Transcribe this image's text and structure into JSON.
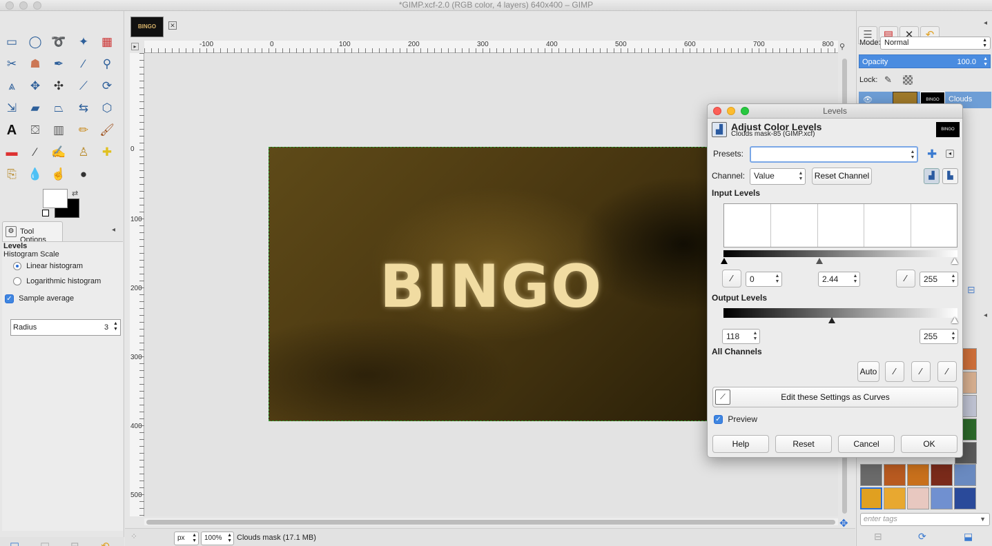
{
  "window": {
    "title": "*GIMP.xcf-2.0 (RGB color, 4 layers) 640x400 – GIMP"
  },
  "image_tab": {
    "thumb_text": "BINGO"
  },
  "rulers": {
    "h_labels": [
      "-100",
      "0",
      "100",
      "200",
      "300",
      "400",
      "500",
      "600",
      "700",
      "800"
    ],
    "v_labels": [
      "0",
      "100",
      "200",
      "300",
      "400",
      "500"
    ]
  },
  "canvas": {
    "image_text": "BINGO"
  },
  "tool_options": {
    "tab_label": "Tool Options",
    "title": "Levels",
    "scale_label": "Histogram Scale",
    "linear_label": "Linear histogram",
    "log_label": "Logarithmic histogram",
    "sample_average_label": "Sample average",
    "radius_label": "Radius",
    "radius_value": "3"
  },
  "status": {
    "unit": "px",
    "zoom": "100%",
    "message": "Clouds mask (17.1 MB)"
  },
  "layers": {
    "mode_label": "Mode:",
    "mode_value": "Normal",
    "opacity_label": "Opacity",
    "opacity_value": "100.0",
    "lock_label": "Lock:",
    "layer_name": "Clouds",
    "tags_placeholder": "enter tags"
  },
  "levels": {
    "window_title": "Levels",
    "heading": "Adjust Color Levels",
    "subheading": "Clouds mask-85 (GIMP.xcf)",
    "thumb_text": "BINGO",
    "presets_label": "Presets:",
    "presets_value": "",
    "channel_label": "Channel:",
    "channel_value": "Value",
    "reset_channel": "Reset Channel",
    "input_levels": "Input Levels",
    "input_low": "0",
    "input_gamma": "2.44",
    "input_high": "255",
    "input_gamma_fraction": 0.41,
    "output_levels": "Output Levels",
    "output_low": "118",
    "output_high": "255",
    "all_channels": "All Channels",
    "auto": "Auto",
    "edit_curves": "Edit these Settings as Curves",
    "preview": "Preview",
    "help": "Help",
    "reset": "Reset",
    "cancel": "Cancel",
    "ok": "OK"
  }
}
